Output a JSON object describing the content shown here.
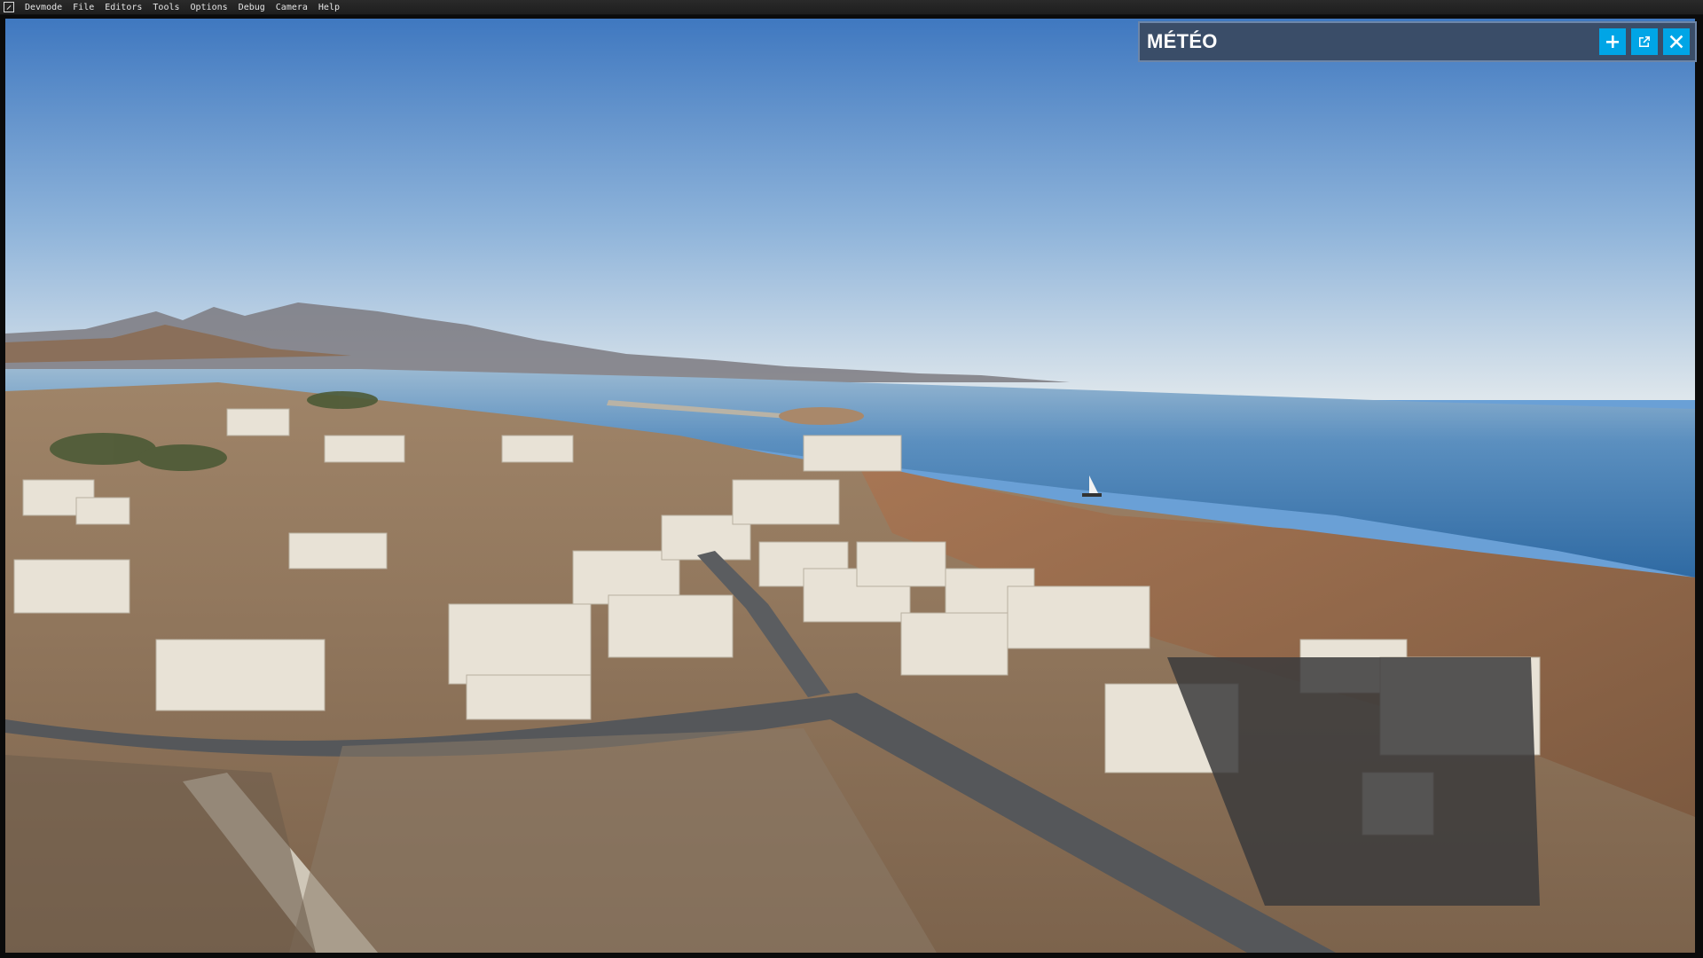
{
  "menubar": {
    "items": [
      "Devmode",
      "File",
      "Editors",
      "Tools",
      "Options",
      "Debug",
      "Camera",
      "Help"
    ]
  },
  "panel": {
    "title": "MÉTÉO",
    "buttons": [
      {
        "name": "add-button",
        "icon": "plus-icon"
      },
      {
        "name": "undock-button",
        "icon": "external-window-icon"
      },
      {
        "name": "close-button",
        "icon": "close-icon"
      }
    ],
    "accent": "#00a5e6",
    "background": "#3a4d68"
  },
  "scene": {
    "description_colors": {
      "sky_top": "#4a7fc4",
      "sky_horizon": "#d8e3ea",
      "sea": "#3d74a8",
      "terrain": "#8d6b4f"
    }
  }
}
